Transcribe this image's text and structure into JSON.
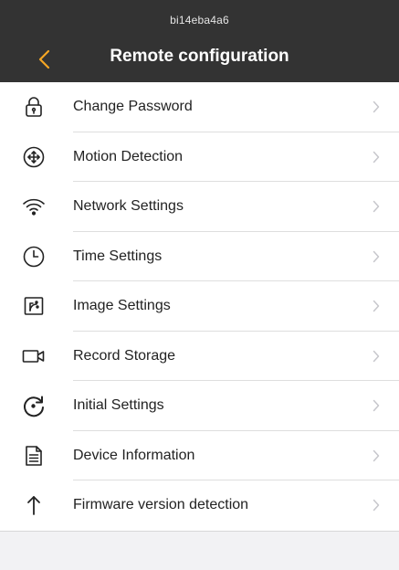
{
  "header": {
    "device_id": "bi14eba4a6",
    "title": "Remote configuration",
    "back_icon": "chevron-left-icon"
  },
  "colors": {
    "header_bg": "#333333",
    "accent": "#f5a623",
    "background": "#f2f2f4",
    "chevron": "#c7c7cc"
  },
  "menu": {
    "items": [
      {
        "label": "Change Password",
        "icon": "lock-icon"
      },
      {
        "label": "Motion Detection",
        "icon": "move-arrows-icon"
      },
      {
        "label": "Network Settings",
        "icon": "wifi-icon"
      },
      {
        "label": "Time Settings",
        "icon": "clock-icon"
      },
      {
        "label": "Image Settings",
        "icon": "image-settings-icon"
      },
      {
        "label": "Record Storage",
        "icon": "video-camera-icon"
      },
      {
        "label": "Initial Settings",
        "icon": "reset-icon"
      },
      {
        "label": "Device Information",
        "icon": "document-icon"
      },
      {
        "label": "Firmware version detection",
        "icon": "arrow-up-icon"
      }
    ]
  }
}
